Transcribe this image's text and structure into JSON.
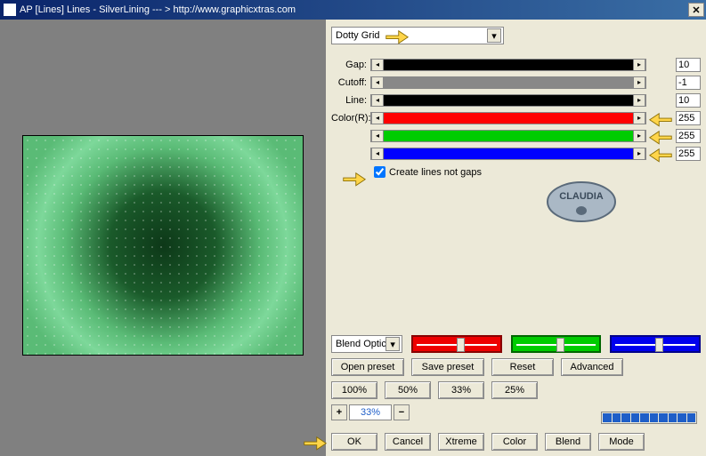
{
  "title": "AP [Lines]  Lines - SilverLining    --- >  http://www.graphicxtras.com",
  "dropdown": "Dotty Grid",
  "sliders": [
    {
      "label": "Gap:",
      "value": "10",
      "fill": "#000"
    },
    {
      "label": "Cutoff:",
      "value": "-1",
      "fill": "#888"
    },
    {
      "label": "Line:",
      "value": "10",
      "fill": "#000"
    },
    {
      "label": "Color(R):",
      "value": "255",
      "fill": "#f00"
    },
    {
      "label": "",
      "value": "255",
      "fill": "#0c0"
    },
    {
      "label": "",
      "value": "255",
      "fill": "#00f"
    }
  ],
  "checkbox": {
    "label": "Create lines not gaps",
    "checked": true
  },
  "blend_dd": "Blend Optic",
  "buttons": {
    "open": "Open preset",
    "save": "Save preset",
    "reset": "Reset",
    "adv": "Advanced"
  },
  "pct_buttons": [
    "100%",
    "50%",
    "33%",
    "25%"
  ],
  "zoom": "33%",
  "bottom_buttons": [
    "OK",
    "Cancel",
    "Xtreme",
    "Color",
    "Blend",
    "Mode"
  ],
  "logo_text": "CLAUDIA"
}
